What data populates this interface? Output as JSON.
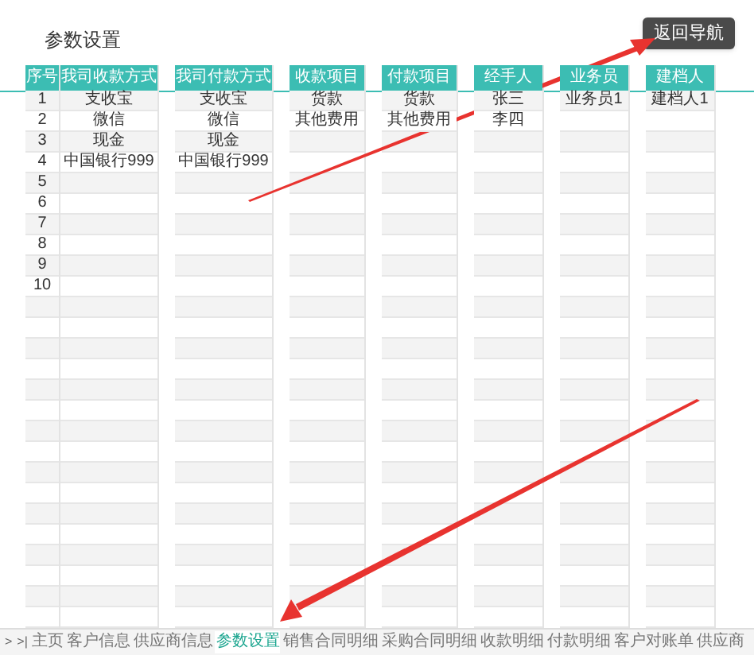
{
  "title": "参数设置",
  "back_button": "返回导航",
  "column_groups": [
    {
      "columns": [
        {
          "header": "序号",
          "kind": "index",
          "values": [
            "1",
            "2",
            "3",
            "4",
            "5",
            "6",
            "7",
            "8",
            "9",
            "10"
          ]
        },
        {
          "header": "我司收款方式",
          "kind": "text",
          "values": [
            "支收宝",
            "微信",
            "现金",
            "中国银行999"
          ]
        }
      ]
    },
    {
      "columns": [
        {
          "header": "我司付款方式",
          "kind": "text",
          "values": [
            "支收宝",
            "微信",
            "现金",
            "中国银行999"
          ]
        }
      ]
    },
    {
      "columns": [
        {
          "header": "收款项目",
          "kind": "text",
          "values": [
            "货款",
            "其他费用"
          ]
        }
      ]
    },
    {
      "columns": [
        {
          "header": "付款项目",
          "kind": "text",
          "values": [
            "货款",
            "其他费用"
          ]
        }
      ]
    },
    {
      "columns": [
        {
          "header": "经手人",
          "kind": "text",
          "values": [
            "张三",
            "李四"
          ]
        }
      ]
    },
    {
      "columns": [
        {
          "header": "业务员",
          "kind": "text",
          "values": [
            "业务员1"
          ]
        }
      ]
    },
    {
      "columns": [
        {
          "header": "建档人",
          "kind": "text",
          "values": [
            "建档人1"
          ]
        }
      ]
    }
  ],
  "sheet_nav": [
    ">",
    ">|"
  ],
  "sheet_tabs": [
    {
      "label": "主页",
      "selected": false
    },
    {
      "label": "客户信息",
      "selected": false
    },
    {
      "label": "供应商信息",
      "selected": false
    },
    {
      "label": "参数设置",
      "selected": true
    },
    {
      "label": "销售合同明细",
      "selected": false
    },
    {
      "label": "采购合同明细",
      "selected": false
    },
    {
      "label": "收款明细",
      "selected": false
    },
    {
      "label": "付款明细",
      "selected": false
    },
    {
      "label": "客户对账单",
      "selected": false
    },
    {
      "label": "供应商",
      "selected": false
    }
  ]
}
